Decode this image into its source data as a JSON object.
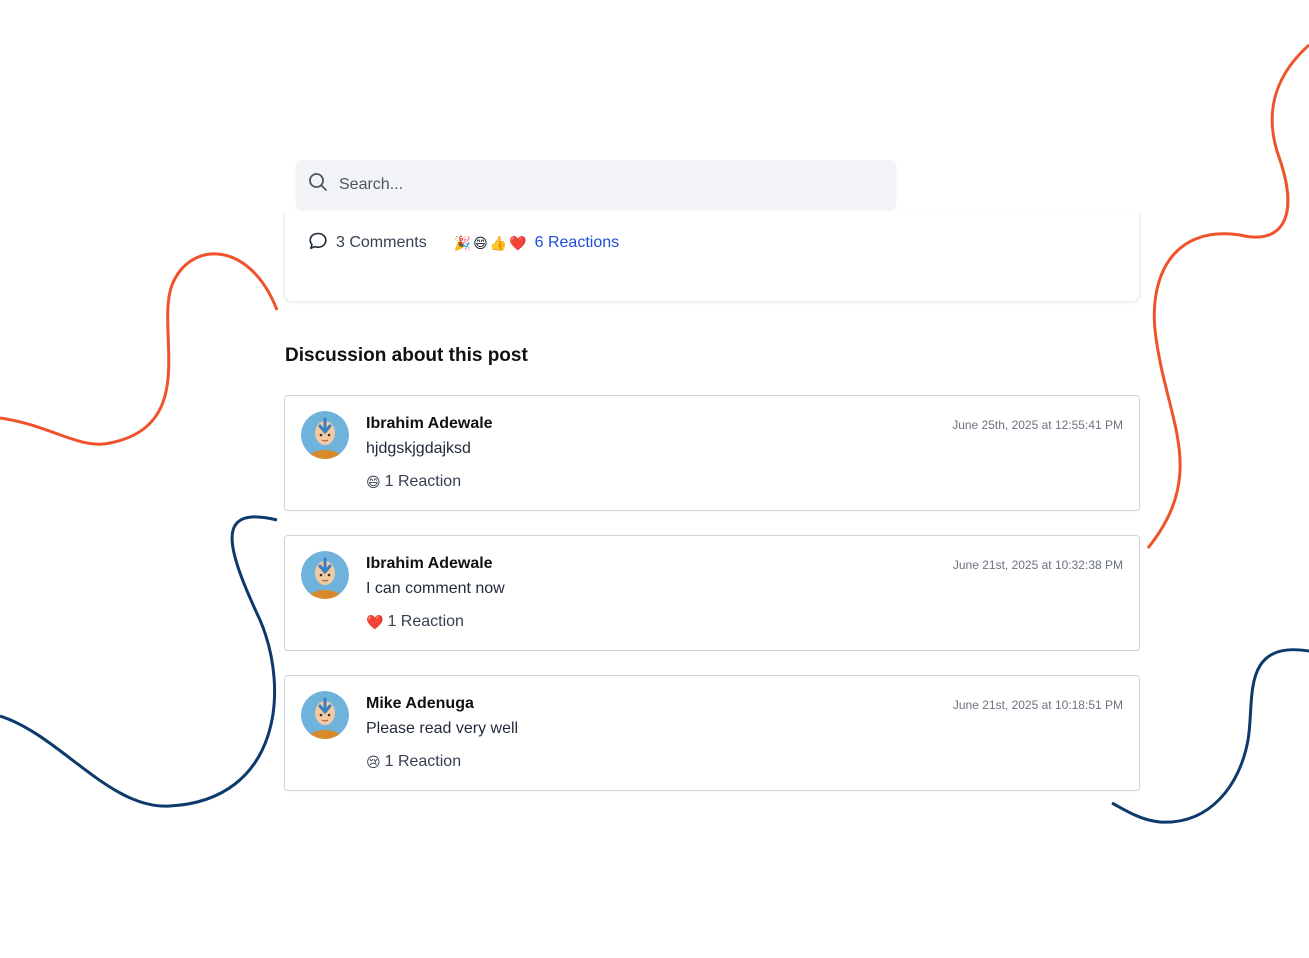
{
  "search": {
    "placeholder": "Search...",
    "icon": "search-icon"
  },
  "post_stats": {
    "comments_label": "3 Comments",
    "comment_icon": "speech-bubble-icon",
    "reaction_emojis": [
      "🎉",
      "😄",
      "👍",
      "❤️"
    ],
    "reactions_label": "6 Reactions"
  },
  "discussion": {
    "title": "Discussion about this post",
    "comments": [
      {
        "author": "Ibrahim Adewale",
        "timestamp": "June 25th, 2025 at 12:55:41 PM",
        "text": "hjdgskjgdajksd",
        "reaction_emoji": "😄",
        "reaction_label": "1 Reaction"
      },
      {
        "author": "Ibrahim Adewale",
        "timestamp": "June 21st, 2025 at 10:32:38 PM",
        "text": "I can comment now",
        "reaction_emoji": "❤️",
        "reaction_label": "1 Reaction"
      },
      {
        "author": "Mike Adenuga",
        "timestamp": "June 21st, 2025 at 10:18:51 PM",
        "text": "Please read very well",
        "reaction_emoji": "😢",
        "reaction_label": "1 Reaction"
      }
    ]
  },
  "colors": {
    "accent_link": "#1d4ed8",
    "decor_orange": "#f0532b",
    "decor_navy": "#0b3a6b"
  }
}
